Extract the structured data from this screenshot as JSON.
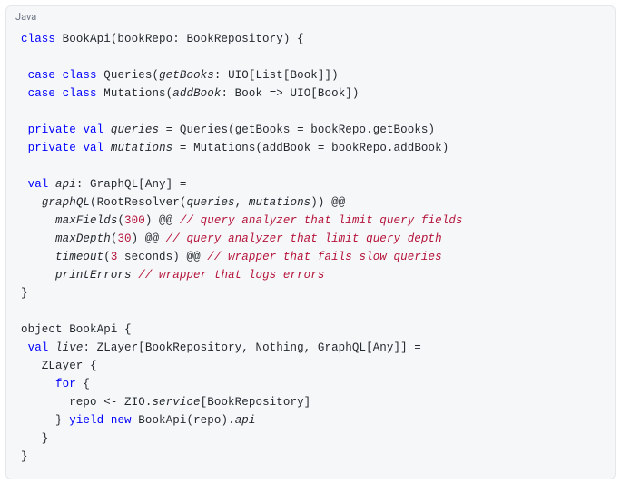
{
  "header": {
    "language": "Java"
  },
  "code": {
    "tokens": [
      [
        {
          "t": "class",
          "c": "kw"
        },
        {
          "t": " BookApi(bookRepo: BookRepository) {"
        }
      ],
      [],
      [
        {
          "t": " "
        },
        {
          "t": "case",
          "c": "kw"
        },
        {
          "t": " "
        },
        {
          "t": "class",
          "c": "kw"
        },
        {
          "t": " Queries("
        },
        {
          "t": "getBooks",
          "c": "ident-i"
        },
        {
          "t": ": UIO[List[Book]])"
        }
      ],
      [
        {
          "t": " "
        },
        {
          "t": "case",
          "c": "kw"
        },
        {
          "t": " "
        },
        {
          "t": "class",
          "c": "kw"
        },
        {
          "t": " Mutations("
        },
        {
          "t": "addBook",
          "c": "ident-i"
        },
        {
          "t": ": Book => UIO[Book])"
        }
      ],
      [],
      [
        {
          "t": " "
        },
        {
          "t": "private",
          "c": "kw"
        },
        {
          "t": " "
        },
        {
          "t": "val",
          "c": "kw"
        },
        {
          "t": " "
        },
        {
          "t": "queries",
          "c": "ident-i"
        },
        {
          "t": " = Queries(getBooks = bookRepo.getBooks)"
        }
      ],
      [
        {
          "t": " "
        },
        {
          "t": "private",
          "c": "kw"
        },
        {
          "t": " "
        },
        {
          "t": "val",
          "c": "kw"
        },
        {
          "t": " "
        },
        {
          "t": "mutations",
          "c": "ident-i"
        },
        {
          "t": " = Mutations(addBook = bookRepo.addBook)"
        }
      ],
      [],
      [
        {
          "t": " "
        },
        {
          "t": "val",
          "c": "kw"
        },
        {
          "t": " "
        },
        {
          "t": "api",
          "c": "ident-i"
        },
        {
          "t": ": GraphQL[Any] ="
        }
      ],
      [
        {
          "t": "   "
        },
        {
          "t": "graphQL",
          "c": "ident-i"
        },
        {
          "t": "(RootResolver("
        },
        {
          "t": "queries",
          "c": "ident-i"
        },
        {
          "t": ", "
        },
        {
          "t": "mutations",
          "c": "ident-i"
        },
        {
          "t": ")) @@"
        }
      ],
      [
        {
          "t": "     "
        },
        {
          "t": "maxFields",
          "c": "ident-i"
        },
        {
          "t": "("
        },
        {
          "t": "300",
          "c": "num"
        },
        {
          "t": ") @@ "
        },
        {
          "t": "// query analyzer that limit query fields",
          "c": "comment"
        }
      ],
      [
        {
          "t": "     "
        },
        {
          "t": "maxDepth",
          "c": "ident-i"
        },
        {
          "t": "("
        },
        {
          "t": "30",
          "c": "num"
        },
        {
          "t": ") @@ "
        },
        {
          "t": "// query analyzer that limit query depth",
          "c": "comment"
        }
      ],
      [
        {
          "t": "     "
        },
        {
          "t": "timeout",
          "c": "ident-i"
        },
        {
          "t": "("
        },
        {
          "t": "3",
          "c": "num"
        },
        {
          "t": " seconds) @@ "
        },
        {
          "t": "// wrapper that fails slow queries",
          "c": "comment"
        }
      ],
      [
        {
          "t": "     "
        },
        {
          "t": "printErrors",
          "c": "ident-i"
        },
        {
          "t": " "
        },
        {
          "t": "// wrapper that logs errors",
          "c": "comment"
        }
      ],
      [
        {
          "t": "}"
        }
      ],
      [],
      [
        {
          "t": "object BookApi {"
        }
      ],
      [
        {
          "t": " "
        },
        {
          "t": "val",
          "c": "kw"
        },
        {
          "t": " "
        },
        {
          "t": "live",
          "c": "ident-i"
        },
        {
          "t": ": ZLayer[BookRepository, Nothing, GraphQL[Any]] ="
        }
      ],
      [
        {
          "t": "   ZLayer {"
        }
      ],
      [
        {
          "t": "     "
        },
        {
          "t": "for",
          "c": "kw"
        },
        {
          "t": " {"
        }
      ],
      [
        {
          "t": "       repo <- ZIO."
        },
        {
          "t": "service",
          "c": "ident-i"
        },
        {
          "t": "[BookRepository]"
        }
      ],
      [
        {
          "t": "     } "
        },
        {
          "t": "yield",
          "c": "kw"
        },
        {
          "t": " "
        },
        {
          "t": "new",
          "c": "kw"
        },
        {
          "t": " BookApi(repo)."
        },
        {
          "t": "api",
          "c": "ident-i"
        }
      ],
      [
        {
          "t": "   }"
        }
      ],
      [
        {
          "t": "}"
        }
      ]
    ]
  }
}
